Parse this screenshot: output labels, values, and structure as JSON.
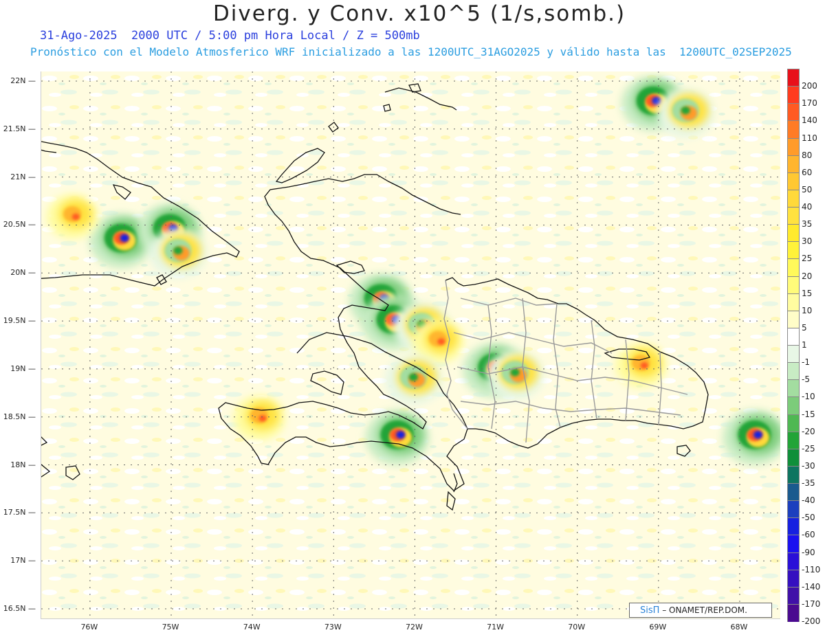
{
  "header": {
    "title": "Diverg. y Conv. x10^5 (1/s,somb.)",
    "subtitle1": "31-Ago-2025  2000 UTC / 5:00 pm Hora Local / Z = 500mb",
    "subtitle2": "Pronóstico con el Modelo Atmosferico WRF inicializado a las 1200UTC_31AGO2025 y válido hasta las  1200UTC_02SEP2025"
  },
  "map": {
    "lat_labels": [
      "22N",
      "21.5N",
      "21N",
      "20.5N",
      "20N",
      "19.5N",
      "19N",
      "18.5N",
      "18N",
      "17.5N",
      "17N",
      "16.5N"
    ],
    "lon_labels": [
      "76W",
      "75W",
      "74W",
      "73W",
      "72W",
      "71W",
      "70W",
      "69W",
      "68W"
    ],
    "lat_values": [
      22,
      21.5,
      21,
      20.5,
      20,
      19.5,
      19,
      18.5,
      18,
      17.5,
      17,
      16.5
    ],
    "lon_values": [
      -76,
      -75,
      -74,
      -73,
      -72,
      -71,
      -70,
      -69,
      -68
    ],
    "extent": {
      "lon_min": -76.6,
      "lon_max": -67.5,
      "lat_min": 16.4,
      "lat_max": 22.1
    },
    "features": [
      {
        "lon": -75.6,
        "lat": 20.35,
        "kind": "conv"
      },
      {
        "lon": -75.0,
        "lat": 20.45,
        "kind": "conv"
      },
      {
        "lon": -74.9,
        "lat": 20.22,
        "kind": "mixed"
      },
      {
        "lon": -72.4,
        "lat": 19.72,
        "kind": "conv"
      },
      {
        "lon": -72.25,
        "lat": 19.5,
        "kind": "conv"
      },
      {
        "lon": -71.9,
        "lat": 19.45,
        "kind": "mixed"
      },
      {
        "lon": -71.7,
        "lat": 19.3,
        "kind": "div"
      },
      {
        "lon": -71.0,
        "lat": 19.0,
        "kind": "conv"
      },
      {
        "lon": -70.75,
        "lat": 18.95,
        "kind": "mixed"
      },
      {
        "lon": -72.2,
        "lat": 18.3,
        "kind": "conv"
      },
      {
        "lon": -72.0,
        "lat": 18.9,
        "kind": "mixed"
      },
      {
        "lon": -69.05,
        "lat": 21.78,
        "kind": "conv"
      },
      {
        "lon": -68.65,
        "lat": 21.68,
        "kind": "mixed"
      },
      {
        "lon": -67.8,
        "lat": 18.3,
        "kind": "conv"
      },
      {
        "lon": -73.9,
        "lat": 18.5,
        "kind": "div"
      },
      {
        "lon": -69.2,
        "lat": 19.05,
        "kind": "div"
      },
      {
        "lon": -76.2,
        "lat": 20.6,
        "kind": "div"
      }
    ]
  },
  "colorbar": {
    "levels": [
      {
        "label": "200",
        "color": "#e8101a"
      },
      {
        "label": "170",
        "color": "#ff3b1f"
      },
      {
        "label": "140",
        "color": "#ff5a22"
      },
      {
        "label": "110",
        "color": "#ff7b25"
      },
      {
        "label": "80",
        "color": "#ff9b2a"
      },
      {
        "label": "60",
        "color": "#ffb52e"
      },
      {
        "label": "50",
        "color": "#ffc832"
      },
      {
        "label": "40",
        "color": "#ffd93a"
      },
      {
        "label": "35",
        "color": "#ffe23f"
      },
      {
        "label": "30",
        "color": "#ffea2d"
      },
      {
        "label": "25",
        "color": "#fff23a"
      },
      {
        "label": "20",
        "color": "#fff95a"
      },
      {
        "label": "15",
        "color": "#fffb7a"
      },
      {
        "label": "10",
        "color": "#fffca0"
      },
      {
        "label": "5",
        "color": "#fffdc8"
      },
      {
        "label": "1",
        "color": "#ffffff"
      },
      {
        "label": "-1",
        "color": "#e8f7e6"
      },
      {
        "label": "-5",
        "color": "#c8ecc4"
      },
      {
        "label": "-10",
        "color": "#a3dda0"
      },
      {
        "label": "-15",
        "color": "#7ccc7a"
      },
      {
        "label": "-20",
        "color": "#4fb853"
      },
      {
        "label": "-25",
        "color": "#22a437"
      },
      {
        "label": "-30",
        "color": "#0f8f3a"
      },
      {
        "label": "-35",
        "color": "#0e7560"
      },
      {
        "label": "-40",
        "color": "#1a5a8e"
      },
      {
        "label": "-50",
        "color": "#1c3fbe"
      },
      {
        "label": "-60",
        "color": "#1620e0"
      },
      {
        "label": "-90",
        "color": "#1a10f0"
      },
      {
        "label": "-110",
        "color": "#2a10d8"
      },
      {
        "label": "-140",
        "color": "#3510c0"
      },
      {
        "label": "-170",
        "color": "#4010a8"
      },
      {
        "label": "-200",
        "color": "#4a0a90"
      }
    ]
  },
  "credit": {
    "brand": "SisΠ",
    "org": " – ONAMET/REP.DOM."
  }
}
